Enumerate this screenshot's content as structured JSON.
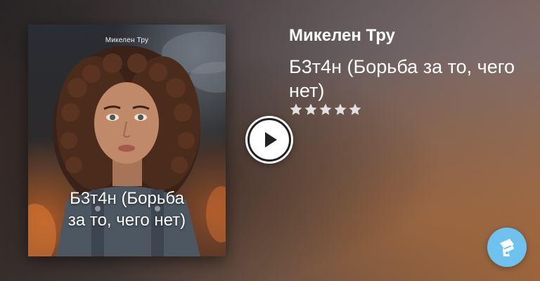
{
  "book": {
    "author": "Микелен Тру",
    "title": "Б3т4н (Борьба за то, чего нет)",
    "rating_stars": 5
  },
  "cover": {
    "author": "Микелен Тру",
    "title_line1": "Б3т4н (Борьба",
    "title_line2": "за то, чего нет)"
  },
  "icons": {
    "play": "play-icon",
    "star": "star-icon",
    "app": "hat-logo-icon"
  },
  "colors": {
    "star": "#e0e0e0",
    "badge": "#6ec2f0"
  }
}
